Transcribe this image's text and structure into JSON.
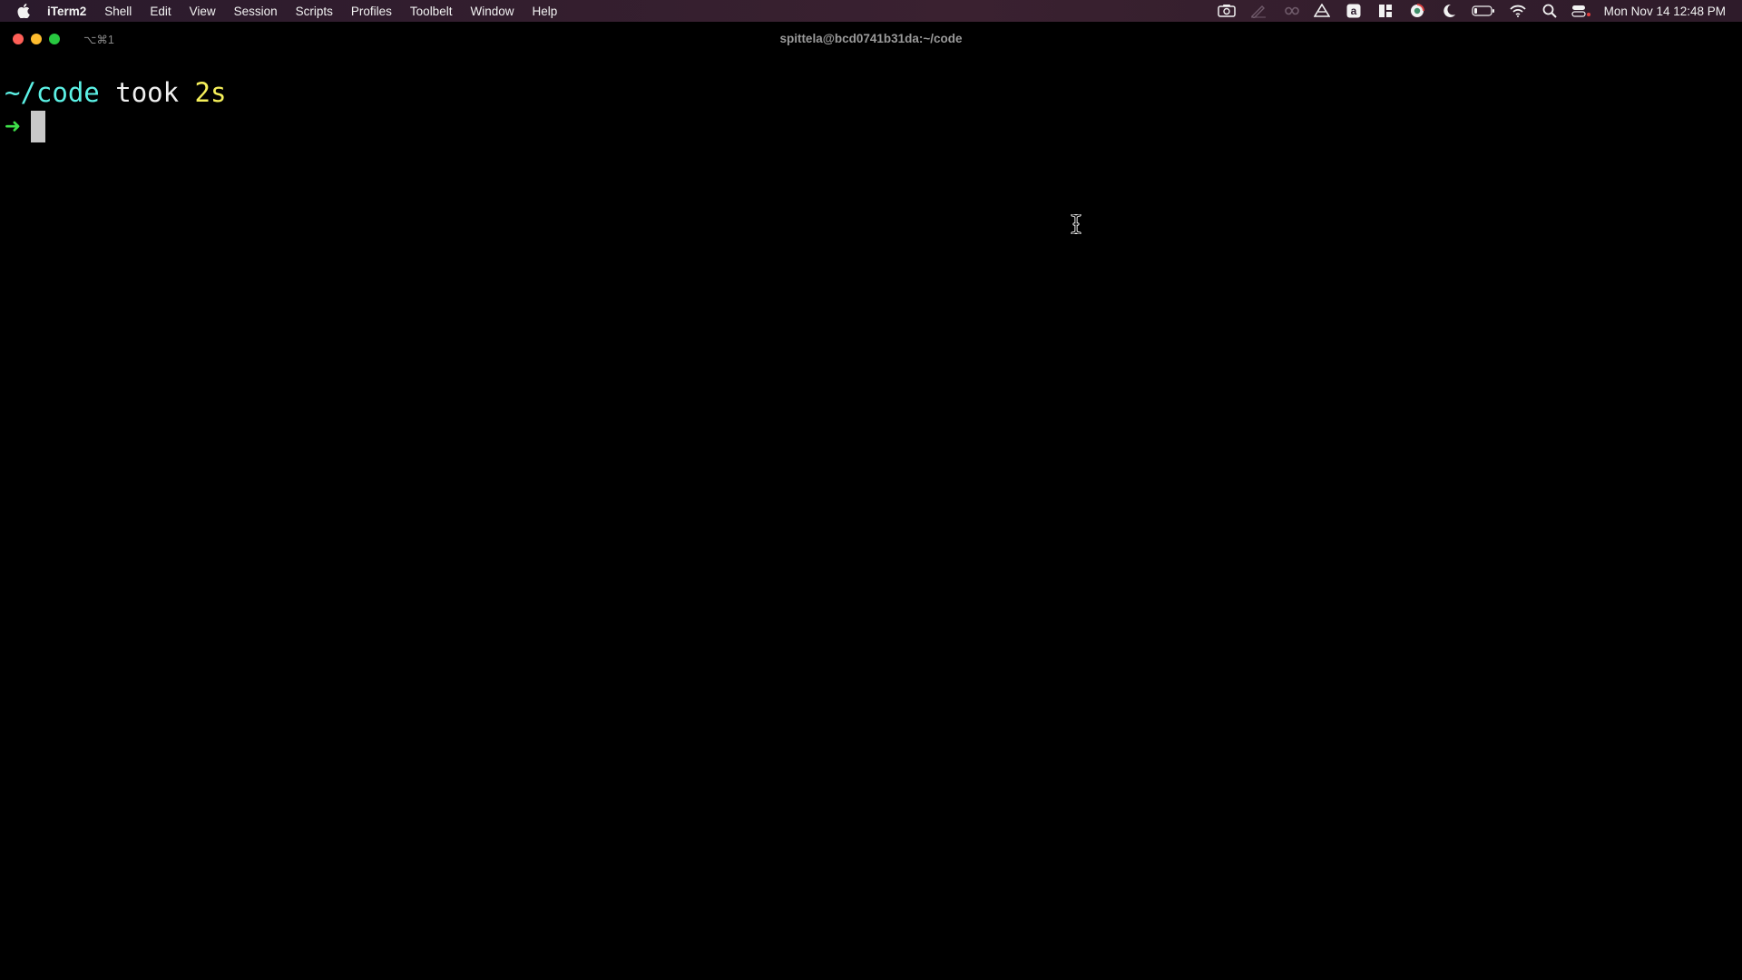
{
  "menubar": {
    "apple_icon": "apple-logo-icon",
    "app_name": "iTerm2",
    "items": [
      "Shell",
      "Edit",
      "View",
      "Session",
      "Scripts",
      "Profiles",
      "Toolbelt",
      "Window",
      "Help"
    ],
    "status_icons": [
      "screen-record-icon",
      "pen-icon",
      "infinity-icon",
      "drive-icon",
      "amazon-icon",
      "layout-icon",
      "globe-icon",
      "moon-icon",
      "battery-icon",
      "wifi-icon",
      "search-icon",
      "control-center-icon"
    ],
    "clock": "Mon Nov 14  12:48 PM"
  },
  "window": {
    "shortcut": "⌥⌘1",
    "title": "spittela@bcd0741b31da:~/code"
  },
  "terminal": {
    "path": "~/code",
    "took": "took",
    "duration": "2s",
    "prompt_symbol": "➜"
  },
  "colors": {
    "path": "#5cf2e6",
    "duration": "#f6f05a",
    "prompt": "#3fe04a",
    "background": "#000000"
  }
}
